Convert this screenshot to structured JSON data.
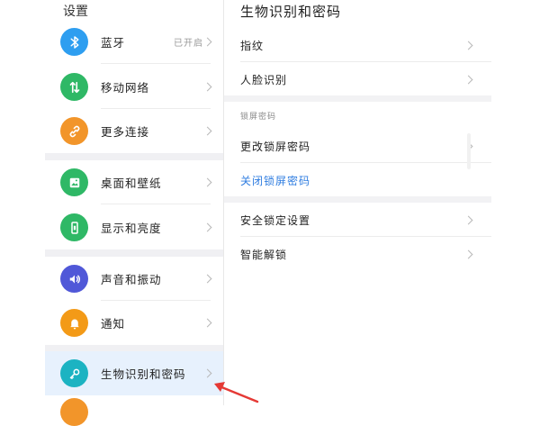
{
  "left": {
    "title": "设置",
    "items": [
      {
        "label": "蓝牙",
        "value": "已开启",
        "icon": "bluetooth-icon",
        "color": "#2e9ef0"
      },
      {
        "label": "移动网络",
        "icon": "mobile-data-icon",
        "color": "#2fb866"
      },
      {
        "label": "更多连接",
        "icon": "link-icon",
        "color": "#f2952a"
      },
      {
        "label": "桌面和壁纸",
        "icon": "wallpaper-icon",
        "color": "#2fb866"
      },
      {
        "label": "显示和亮度",
        "icon": "display-icon",
        "color": "#2fb866"
      },
      {
        "label": "声音和振动",
        "icon": "sound-icon",
        "color": "#5058d8"
      },
      {
        "label": "通知",
        "icon": "bell-icon",
        "color": "#f39a17"
      },
      {
        "label": "生物识别和密码",
        "icon": "key-icon",
        "color": "#1cb3c2",
        "selected": true
      }
    ]
  },
  "right": {
    "title": "生物识别和密码",
    "group1": [
      {
        "label": "指纹"
      },
      {
        "label": "人脸识别"
      }
    ],
    "section_label": "锁屏密码",
    "group2": [
      {
        "label": "更改锁屏密码"
      },
      {
        "label": "关闭锁屏密码",
        "style": "link",
        "color": "#2f7de0"
      }
    ],
    "group3": [
      {
        "label": "安全锁定设置"
      },
      {
        "label": "智能解锁"
      }
    ]
  },
  "colors": {
    "selected_bg": "#e7f1fd",
    "annotation_arrow": "#e53935"
  }
}
